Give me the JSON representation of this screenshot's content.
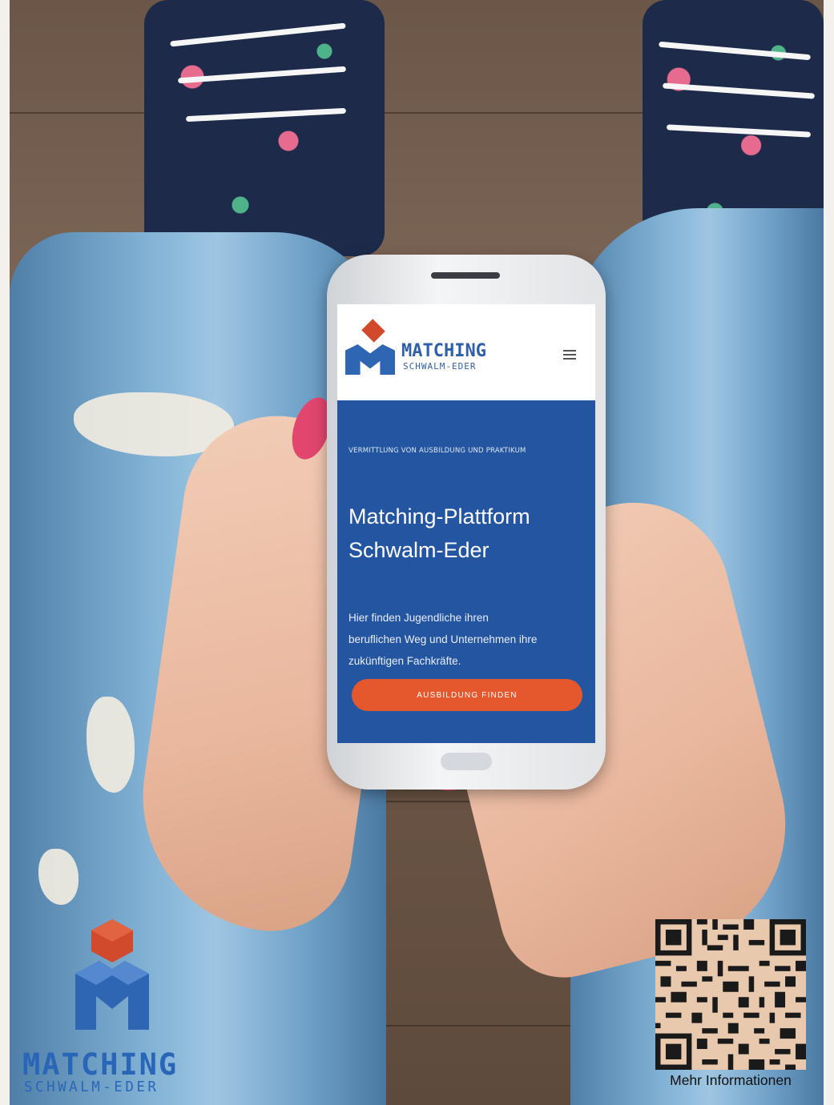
{
  "screen": {
    "logo_word": "MATCHING",
    "logo_sub": "SCHWALM-EDER",
    "kicker": "VERMITTLUNG VON AUSBILDUNG UND PRAKTIKUM",
    "title_line1": "Matching-Plattform",
    "title_line2": "Schwalm-Eder",
    "text_line1": "Hier finden Jugendliche ihren",
    "text_line2": "beruflichen Weg und Unternehmen ihre",
    "text_line3": "zukünftigen Fachkräfte.",
    "cta_label": "AUSBILDUNG FINDEN"
  },
  "brand": {
    "word": "MATCHING",
    "sub": "SCHWALM-EDER"
  },
  "qr": {
    "caption": "Mehr Informationen"
  },
  "colors": {
    "brand_blue": "#2a66b8",
    "brand_red": "#d24a2c",
    "hero_blue": "#2355a0",
    "cta_orange": "#e5582e"
  }
}
